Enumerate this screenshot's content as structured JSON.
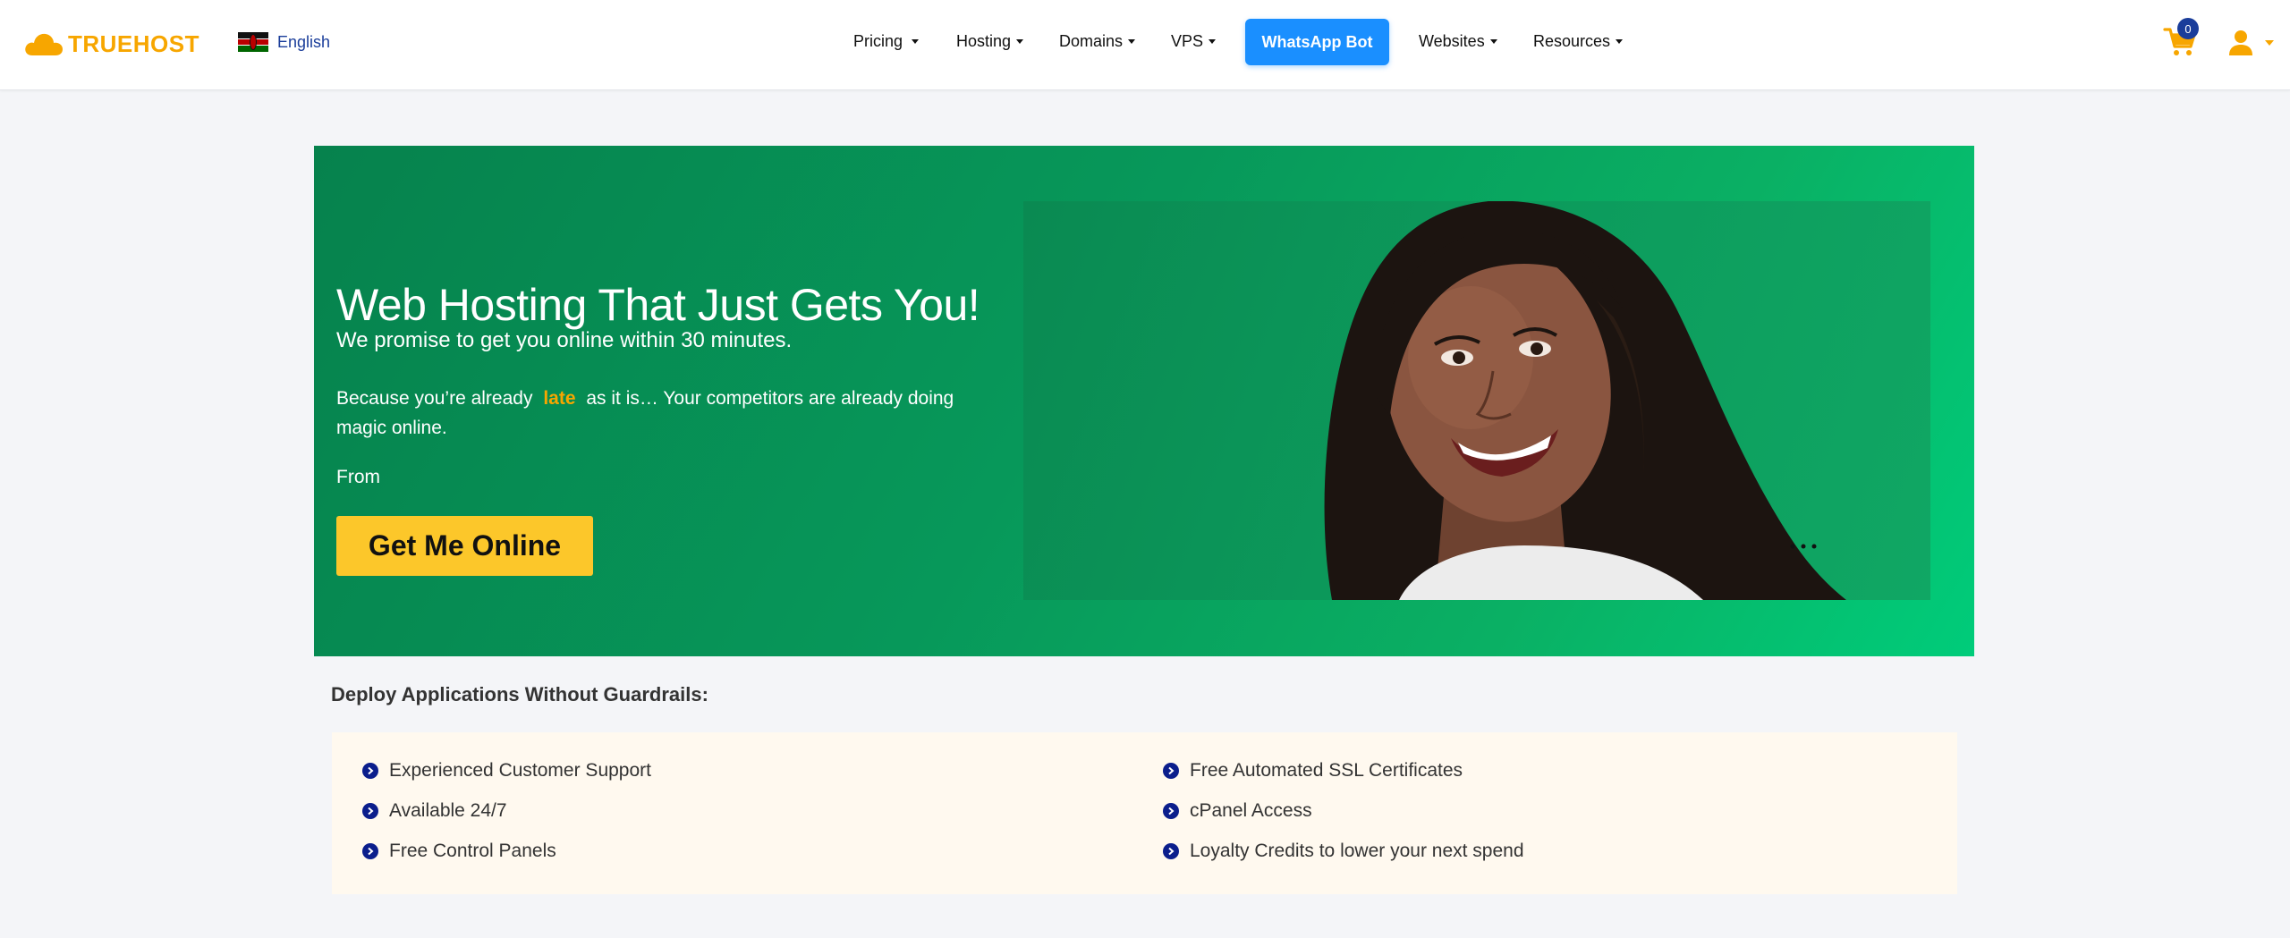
{
  "header": {
    "brand": "TRUEHOST",
    "language": "English",
    "nav": [
      {
        "label": "Pricing"
      },
      {
        "label": "Hosting"
      },
      {
        "label": "Domains"
      },
      {
        "label": "VPS"
      },
      {
        "label": "Websites"
      },
      {
        "label": "Resources"
      }
    ],
    "whatsapp_label": "WhatsApp Bot",
    "cart_count": "0",
    "colors": {
      "brand": "#f7a600",
      "whatsapp": "#1a8fff",
      "badge": "#1a3d9a"
    }
  },
  "hero": {
    "title": "Web Hosting That Just Gets You!",
    "subtitle": "We promise to get you online within 30 minutes.",
    "text_before": "Because you’re already",
    "highlight": "late",
    "text_after": "as it is… Your competitors are already doing magic online.",
    "from_label": "From",
    "cta_label": "Get Me Online",
    "image_alt": "smiling-woman-photo",
    "colors": {
      "bg_start": "#06824d",
      "bg_end": "#00cc7a",
      "cta": "#fcc72a",
      "highlight": "#f7a600"
    }
  },
  "features_section": {
    "title": "Deploy Applications Without Guardrails:",
    "left": [
      "Experienced Customer Support",
      "Available 24/7",
      "Free Control Panels"
    ],
    "right": [
      "Free Automated SSL Certificates",
      "cPanel Access",
      "Loyalty Credits to lower your next spend"
    ]
  }
}
